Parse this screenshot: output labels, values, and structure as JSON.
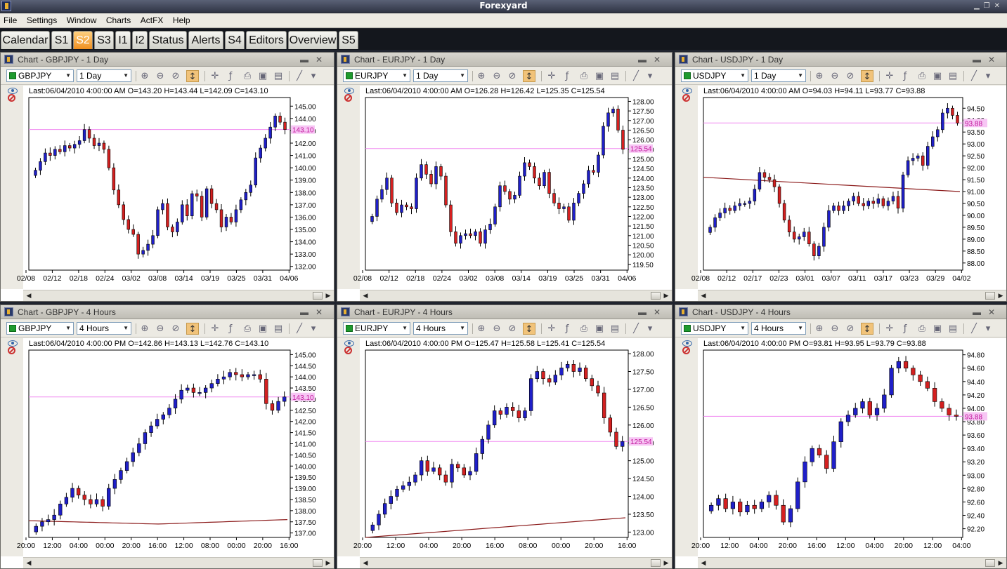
{
  "window": {
    "title": "Forexyard"
  },
  "menu": [
    "File",
    "Settings",
    "Window",
    "Charts",
    "ActFX",
    "Help"
  ],
  "tabs": [
    {
      "label": "Calendar",
      "active": false
    },
    {
      "label": "S1",
      "active": false
    },
    {
      "label": "S2",
      "active": true
    },
    {
      "label": "S3",
      "active": false
    },
    {
      "label": "I1",
      "active": false
    },
    {
      "label": "I2",
      "active": false
    },
    {
      "label": "Status",
      "active": false
    },
    {
      "label": "Alerts",
      "active": false
    },
    {
      "label": "S4",
      "active": false
    },
    {
      "label": "Editors",
      "active": false
    },
    {
      "label": "Overview",
      "active": false
    },
    {
      "label": "S5",
      "active": false
    }
  ],
  "colors": {
    "bull": "#1f1fc8",
    "bear": "#d42020",
    "last_price_line": "#f08af0",
    "ma_line": "#8b1a1a"
  },
  "charts": [
    {
      "title": "Chart - GBPJPY - 1 Day",
      "symbol": "GBPJPY",
      "timeframe": "1 Day",
      "info": "Last:06/04/2010 4:00:00 AM O=143.20 H=143.44 L=142.09 C=143.10",
      "chart_data": {
        "type": "candlestick",
        "y_ticks": [
          "145.00",
          "144.00",
          "143.00",
          "142.00",
          "141.00",
          "140.00",
          "139.00",
          "138.00",
          "137.00",
          "136.00",
          "135.00",
          "134.00",
          "133.00",
          "132.00"
        ],
        "ylim": [
          131.7,
          145.7
        ],
        "x_ticks": [
          "02/08",
          "02/12",
          "02/18",
          "02/24",
          "03/02",
          "03/08",
          "03/14",
          "03/19",
          "03/25",
          "03/31",
          "04/06"
        ],
        "last_price": "143.10",
        "last_value": 143.1,
        "ma": null,
        "close": [
          139.8,
          140.5,
          141.2,
          141.0,
          141.5,
          141.3,
          141.8,
          141.6,
          141.9,
          142.2,
          143.1,
          142.4,
          141.8,
          142.0,
          141.5,
          140.0,
          138.2,
          137.0,
          135.8,
          135.0,
          134.6,
          133.0,
          133.3,
          133.8,
          134.5,
          136.6,
          137.1,
          135.2,
          134.8,
          135.6,
          137.0,
          136.1,
          137.9,
          137.7,
          136.0,
          138.3,
          137.1,
          136.6,
          135.2,
          136.0,
          135.6,
          136.6,
          137.4,
          138.0,
          138.6,
          140.8,
          141.6,
          142.4,
          143.3,
          144.2,
          143.7,
          143.1
        ],
        "max_y": 144.9,
        "min_y": 132.2
      }
    },
    {
      "title": "Chart - EURJPY - 1 Day",
      "symbol": "EURJPY",
      "timeframe": "1 Day",
      "info": "Last:06/04/2010 4:00:00 AM O=126.28 H=126.42 L=125.35 C=125.54",
      "chart_data": {
        "type": "candlestick",
        "y_ticks": [
          "128.00",
          "127.50",
          "127.00",
          "126.50",
          "126.00",
          "125.50",
          "125.00",
          "124.50",
          "124.00",
          "123.50",
          "123.00",
          "122.50",
          "122.00",
          "121.50",
          "121.00",
          "120.50",
          "120.00",
          "119.50"
        ],
        "ylim": [
          119.2,
          128.2
        ],
        "x_ticks": [
          "02/08",
          "02/12",
          "02/18",
          "02/24",
          "03/02",
          "03/08",
          "03/14",
          "03/19",
          "03/25",
          "03/31",
          "04/06"
        ],
        "last_price": "125.54",
        "last_value": 125.54,
        "ma": null,
        "close": [
          122.0,
          122.9,
          123.4,
          124.0,
          122.7,
          122.2,
          122.6,
          122.5,
          122.4,
          124.0,
          124.7,
          124.2,
          123.7,
          124.6,
          124.1,
          122.6,
          121.2,
          120.6,
          121.0,
          121.1,
          121.0,
          121.2,
          120.6,
          121.3,
          121.6,
          122.5,
          123.6,
          123.3,
          122.9,
          123.1,
          124.1,
          124.8,
          124.6,
          124.0,
          123.6,
          124.3,
          123.2,
          122.7,
          122.4,
          122.5,
          121.8,
          122.7,
          123.2,
          123.7,
          124.4,
          124.3,
          125.2,
          126.7,
          127.4,
          127.6,
          126.5,
          125.5
        ],
        "max_y": 127.7,
        "min_y": 119.8
      }
    },
    {
      "title": "Chart - USDJPY - 1 Day",
      "symbol": "USDJPY",
      "timeframe": "1 Day",
      "info": "Last:06/04/2010 4:00:00 AM O=94.03 H=94.11 L=93.77 C=93.88",
      "chart_data": {
        "type": "candlestick",
        "y_ticks": [
          "94.50",
          "94.00",
          "93.50",
          "93.00",
          "92.50",
          "92.00",
          "91.50",
          "91.00",
          "90.50",
          "90.00",
          "89.50",
          "89.00",
          "88.50",
          "88.00"
        ],
        "ylim": [
          87.7,
          94.95
        ],
        "x_ticks": [
          "02/08",
          "02/12",
          "02/17",
          "02/23",
          "03/01",
          "03/07",
          "03/11",
          "03/17",
          "03/23",
          "03/29",
          "04/02"
        ],
        "last_price": "93.88",
        "last_value": 93.88,
        "ma": [
          91.6,
          91.0
        ],
        "close": [
          89.5,
          89.9,
          90.1,
          90.3,
          90.2,
          90.4,
          90.5,
          90.5,
          90.6,
          91.1,
          91.8,
          91.6,
          91.5,
          91.2,
          90.5,
          89.8,
          89.3,
          89.0,
          89.1,
          89.3,
          88.8,
          88.3,
          88.7,
          89.5,
          90.2,
          90.4,
          90.2,
          90.4,
          90.6,
          90.8,
          90.5,
          90.4,
          90.6,
          90.5,
          90.7,
          90.4,
          90.6,
          90.8,
          90.3,
          91.7,
          92.3,
          92.4,
          92.5,
          92.1,
          92.9,
          93.3,
          93.6,
          94.3,
          94.5,
          94.2,
          93.88
        ],
        "max_y": 94.6,
        "min_y": 88.1
      }
    },
    {
      "title": "Chart - GBPJPY - 4 Hours",
      "symbol": "GBPJPY",
      "timeframe": "4 Hours",
      "info": "Last:06/04/2010 4:00:00 PM O=142.86 H=143.13 L=142.76 C=143.10",
      "chart_data": {
        "type": "candlestick",
        "y_ticks": [
          "145.00",
          "144.50",
          "144.00",
          "143.50",
          "143.00",
          "142.50",
          "142.00",
          "141.50",
          "141.00",
          "140.50",
          "140.00",
          "139.50",
          "139.00",
          "138.50",
          "138.00",
          "137.50",
          "137.00"
        ],
        "ylim": [
          136.8,
          145.2
        ],
        "x_ticks": [
          "20:00",
          "12:00",
          "04:00",
          "00:00",
          "20:00",
          "16:00",
          "12:00",
          "08:00",
          "00:00",
          "20:00",
          "16:00"
        ],
        "last_price": "143.10",
        "last_value": 143.1,
        "ma": [
          137.55,
          137.4,
          137.6
        ],
        "close": [
          137.3,
          137.5,
          137.6,
          137.8,
          138.3,
          138.6,
          139.0,
          138.7,
          138.5,
          138.3,
          138.5,
          138.2,
          139.0,
          139.4,
          139.8,
          140.2,
          140.6,
          141.0,
          141.5,
          141.8,
          142.1,
          142.3,
          142.6,
          143.0,
          143.4,
          143.5,
          143.3,
          143.3,
          143.5,
          143.7,
          143.9,
          144.0,
          144.2,
          144.1,
          144.0,
          144.1,
          144.1,
          143.9,
          142.8,
          142.5,
          142.9,
          143.1
        ],
        "max_y": 144.8,
        "min_y": 137.0
      }
    },
    {
      "title": "Chart - EURJPY - 4 Hours",
      "symbol": "EURJPY",
      "timeframe": "4 Hours",
      "info": "Last:06/04/2010 4:00:00 PM O=125.47 H=125.58 L=125.41 C=125.54",
      "chart_data": {
        "type": "candlestick",
        "y_ticks": [
          "128.00",
          "127.50",
          "127.00",
          "126.50",
          "126.00",
          "125.50",
          "125.00",
          "124.50",
          "124.00",
          "123.50",
          "123.00"
        ],
        "ylim": [
          122.85,
          128.1
        ],
        "x_ticks": [
          "20:00",
          "12:00",
          "04:00",
          "20:00",
          "16:00",
          "08:00",
          "00:00",
          "20:00",
          "16:00"
        ],
        "last_price": "125.54",
        "last_value": 125.54,
        "ma": [
          122.85,
          123.4
        ],
        "close": [
          123.2,
          123.5,
          123.8,
          124.0,
          124.2,
          124.3,
          124.4,
          124.6,
          125.0,
          124.7,
          124.8,
          124.6,
          124.4,
          124.9,
          124.8,
          124.6,
          124.7,
          125.2,
          125.6,
          126.0,
          126.4,
          126.3,
          126.5,
          126.4,
          126.2,
          126.4,
          127.3,
          127.5,
          127.3,
          127.2,
          127.4,
          127.6,
          127.7,
          127.5,
          127.6,
          127.3,
          127.1,
          126.9,
          126.2,
          125.8,
          125.4,
          125.54
        ],
        "max_y": 127.9,
        "min_y": 123.0
      }
    },
    {
      "title": "Chart - USDJPY - 4 Hours",
      "symbol": "USDJPY",
      "timeframe": "4 Hours",
      "info": "Last:06/04/2010 4:00:00 PM O=93.81 H=93.95 L=93.79 C=93.88",
      "chart_data": {
        "type": "candlestick",
        "y_ticks": [
          "94.80",
          "94.60",
          "94.40",
          "94.20",
          "94.00",
          "93.80",
          "93.60",
          "93.40",
          "93.20",
          "93.00",
          "92.80",
          "92.60",
          "92.40",
          "92.20"
        ],
        "ylim": [
          92.07,
          94.87
        ],
        "x_ticks": [
          "20:00",
          "12:00",
          "04:00",
          "20:00",
          "16:00",
          "12:00",
          "04:00",
          "20:00",
          "12:00",
          "04:00"
        ],
        "last_price": "93.88",
        "last_value": 93.88,
        "ma": null,
        "close": [
          92.55,
          92.65,
          92.5,
          92.6,
          92.45,
          92.55,
          92.5,
          92.6,
          92.7,
          92.55,
          92.3,
          92.5,
          92.9,
          93.2,
          93.4,
          93.3,
          93.1,
          93.5,
          93.8,
          93.9,
          94.0,
          94.1,
          93.9,
          94.0,
          94.2,
          94.6,
          94.7,
          94.6,
          94.5,
          94.4,
          94.3,
          94.1,
          94.0,
          93.9,
          93.88
        ],
        "max_y": 94.78,
        "min_y": 92.15
      }
    }
  ]
}
